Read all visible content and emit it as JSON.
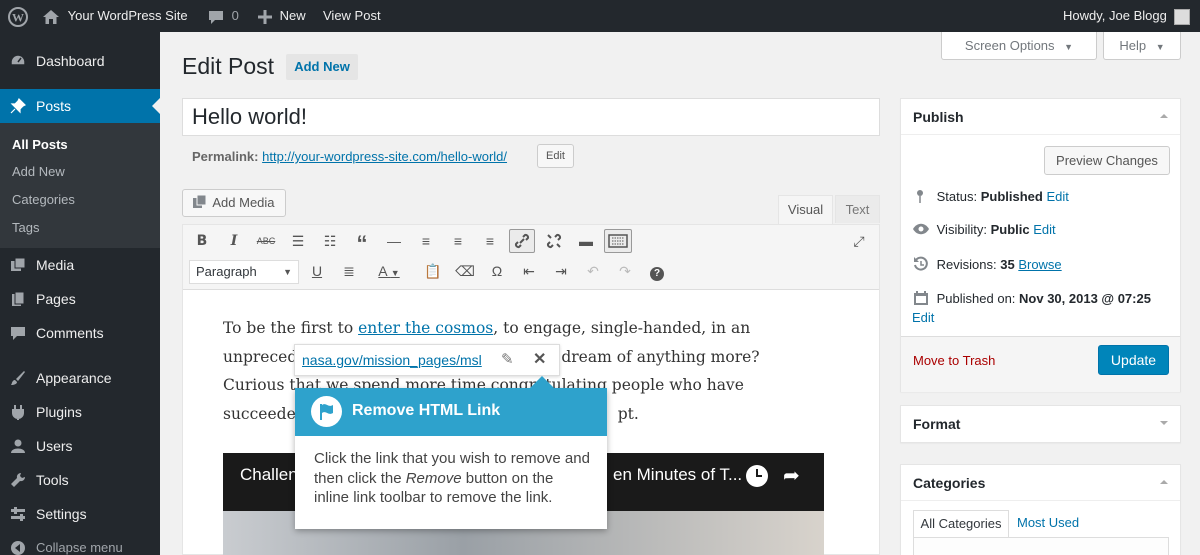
{
  "admin_bar": {
    "site_name": "Your WordPress Site",
    "comments_count": "0",
    "new_label": "New",
    "view_post": "View Post",
    "howdy": "Howdy, Joe Blogg"
  },
  "menu": {
    "dashboard": "Dashboard",
    "posts": "Posts",
    "posts_sub": [
      "All Posts",
      "Add New",
      "Categories",
      "Tags"
    ],
    "media": "Media",
    "pages": "Pages",
    "comments": "Comments",
    "appearance": "Appearance",
    "plugins": "Plugins",
    "users": "Users",
    "tools": "Tools",
    "settings": "Settings",
    "collapse": "Collapse menu"
  },
  "header": {
    "title": "Edit Post",
    "add_new": "Add New",
    "screen_options": "Screen Options",
    "help": "Help"
  },
  "post": {
    "title": "Hello world!",
    "permalink_label": "Permalink:",
    "permalink_url": "http://your-wordpress-site.com/hello-world/",
    "edit": "Edit"
  },
  "editor": {
    "add_media": "Add Media",
    "tab_visual": "Visual",
    "tab_text": "Text",
    "format": "Paragraph",
    "p1_a": "To be the first to ",
    "p1_link": "enter the cosmos",
    "p1_b": ", to engage, single-handed, in an",
    "p2_a": "unpreced",
    "p2_b": "he dream of anything more?",
    "p3_a": "Curious t",
    "p3_b": "hat we spend more time con",
    "p3_c": "gratulating people who have",
    "p4_a": "succeede",
    "p4_b": "pt.",
    "video_left": "Challen",
    "video_right": "en Minutes of T..."
  },
  "link_toolbar": {
    "url": "nasa.gov/mission_pages/msl"
  },
  "tooltip": {
    "title": "Remove HTML Link",
    "body_a": "Click the link that you wish to remove and then click the ",
    "body_em": "Remove",
    "body_b": " button on the  inline link toolbar to remove the link."
  },
  "publish": {
    "title": "Publish",
    "preview": "Preview Changes",
    "status_label": "Status:",
    "status_value": "Published",
    "visibility_label": "Visibility:",
    "visibility_value": "Public",
    "revisions_label": "Revisions:",
    "revisions_value": "35",
    "browse": "Browse",
    "published_label": "Published on:",
    "published_value": "Nov 30, 2013 @ 07:25",
    "edit": "Edit",
    "trash": "Move to Trash",
    "update": "Update"
  },
  "format_box": {
    "title": "Format"
  },
  "categories_box": {
    "title": "Categories",
    "tab_all": "All Categories",
    "tab_used": "Most Used"
  },
  "colors": {
    "accent": "#0073aa",
    "tooltip": "#2ea2cc",
    "trash": "#a00",
    "bar": "#23282d"
  }
}
